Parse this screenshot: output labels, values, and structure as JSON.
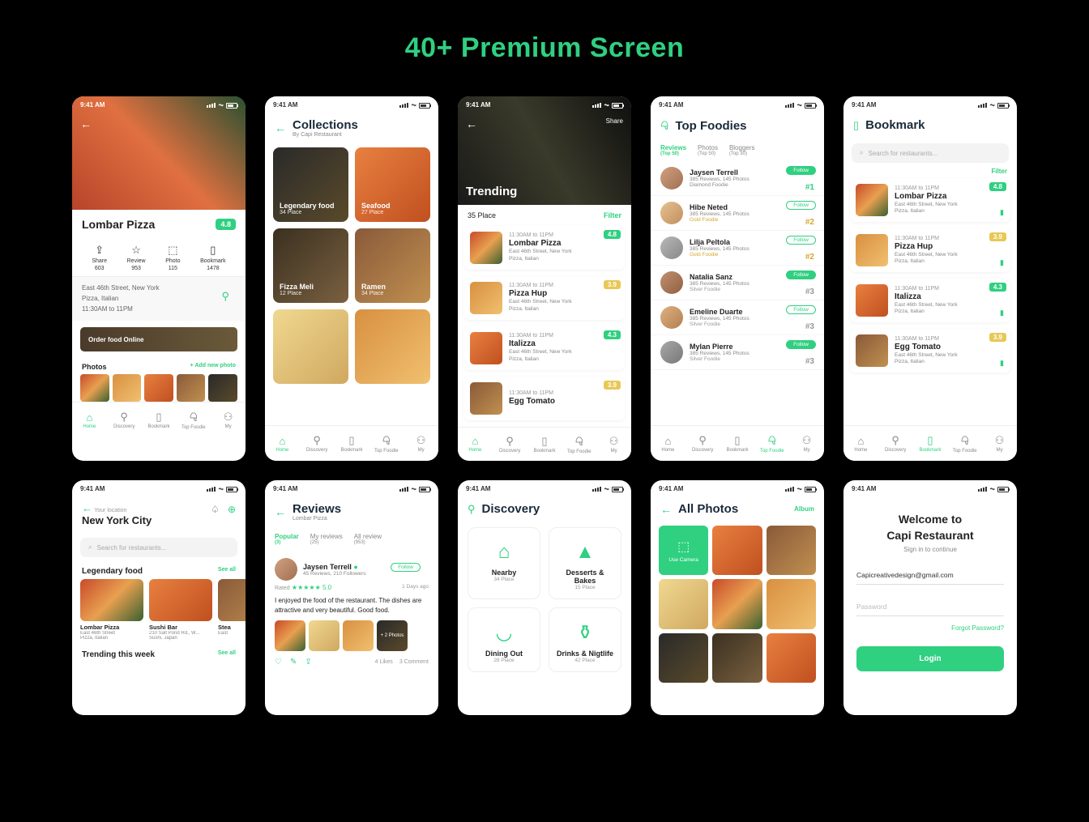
{
  "headline": "40+ Premium Screen",
  "statusTime": "9:41 AM",
  "nav": {
    "home": "Home",
    "discovery": "Discovery",
    "bookmark": "Bookmark",
    "topfoodie": "Top Foodie",
    "my": "My"
  },
  "s1": {
    "title": "Lombar Pizza",
    "rating": "4.8",
    "actions": {
      "share": {
        "l": "Share",
        "c": "603"
      },
      "review": {
        "l": "Review",
        "c": "953"
      },
      "photo": {
        "l": "Photo",
        "c": "115"
      },
      "bookmark": {
        "l": "Bookmark",
        "c": "1478"
      }
    },
    "addr": "East 46th Street, New York",
    "tags": "Pizza, Italian",
    "hours": "11:30AM to 11PM",
    "order": "Order food Online",
    "photos": "Photos",
    "addnew": "+ Add new photo"
  },
  "s2": {
    "title": "Collections",
    "sub": "By Capi Restaurant",
    "c": [
      {
        "n": "Legendary food",
        "p": "34 Place"
      },
      {
        "n": "Seafood",
        "p": "27 Place"
      },
      {
        "n": "Fizza Meli",
        "p": "12 Place"
      },
      {
        "n": "Ramen",
        "p": "34 Place"
      }
    ]
  },
  "s3": {
    "share": "Share",
    "hero": "Trending",
    "count": "35 Place",
    "filter": "Filter",
    "items": [
      {
        "t": "11:30AM to 11PM",
        "n": "Lombar Pizza",
        "a": "East 46th Street, New York",
        "g": "Pizza, Italian",
        "r": "4.8",
        "c": "g"
      },
      {
        "t": "11:30AM to 11PM",
        "n": "Pizza Hup",
        "a": "East 46th Street, New York",
        "g": "Pizza, Italian",
        "r": "3.9",
        "c": "y"
      },
      {
        "t": "11:30AM to 11PM",
        "n": "Italizza",
        "a": "East 46th Street, New York",
        "g": "Pizza, Italian",
        "r": "4.3",
        "c": "g"
      },
      {
        "t": "11:30AM to 11PM",
        "n": "Egg Tomato",
        "a": "",
        "g": "",
        "r": "3.9",
        "c": "y"
      }
    ]
  },
  "s4": {
    "title": "Top Foodies",
    "tabs": [
      {
        "l": "Reviews",
        "s": "(Top 50)"
      },
      {
        "l": "Photos",
        "s": "(Top 50)"
      },
      {
        "l": "Bloggers",
        "s": "(Top 30)"
      }
    ],
    "list": [
      {
        "n": "Jaysen Terrell",
        "s": "385 Reviews, 145 Photos",
        "tier": "Diamond Foodie",
        "tc": "diamond",
        "rank": "#1",
        "rc": "#2fd080",
        "f": true
      },
      {
        "n": "Hibe Neted",
        "s": "385 Reviews, 145 Photos",
        "tier": "Gold Foodie",
        "tc": "gold",
        "rank": "#2",
        "rc": "#d4a830",
        "f": false
      },
      {
        "n": "Lilja Peltola",
        "s": "385 Reviews, 145 Photos",
        "tier": "Gold Foodie",
        "tc": "gold",
        "rank": "#2",
        "rc": "#d4a830",
        "f": false
      },
      {
        "n": "Natalia Sanz",
        "s": "385 Reviews, 145 Photos",
        "tier": "Silver Foodie",
        "tc": "silver",
        "rank": "#3",
        "rc": "#999",
        "f": true
      },
      {
        "n": "Emeline Duarte",
        "s": "385 Reviews, 145 Photos",
        "tier": "Silver Foodie",
        "tc": "silver",
        "rank": "#3",
        "rc": "#999",
        "f": false
      },
      {
        "n": "Mylan Pierre",
        "s": "385 Reviews, 145 Photos",
        "tier": "Silver Foodie",
        "tc": "silver",
        "rank": "#3",
        "rc": "#999",
        "f": true
      }
    ],
    "follow": "Follow"
  },
  "s5": {
    "title": "Bookmark",
    "search": "Search for restaurants...",
    "filter": "Filter",
    "items": [
      {
        "t": "11:30AM to 11PM",
        "n": "Lombar Pizza",
        "a": "East 46th Street, New York",
        "g": "Pizza, Italian",
        "r": "4.8",
        "c": "g"
      },
      {
        "t": "11:30AM to 11PM",
        "n": "Pizza Hup",
        "a": "East 46th Street, New York",
        "g": "Pizza, Italian",
        "r": "3.9",
        "c": "y"
      },
      {
        "t": "11:30AM to 11PM",
        "n": "Italizza",
        "a": "East 46th Street, New York",
        "g": "Pizza, Italian",
        "r": "4.3",
        "c": "g"
      },
      {
        "t": "11:30AM to 11PM",
        "n": "Egg Tomato",
        "a": "East 46th Street, New York",
        "g": "Pizza, Italian",
        "r": "3.9",
        "c": "y"
      }
    ]
  },
  "s6": {
    "locLabel": "Your location",
    "city": "New York City",
    "search": "Search for restaurants...",
    "sec1": "Legendary food",
    "sec2": "Trending this week",
    "seeall": "See all",
    "cards": [
      {
        "n": "Lombar Pizza",
        "a": "East 46th Street",
        "g": "Pizza, Italian"
      },
      {
        "n": "Sushi Bar",
        "a": "210 Salt Pond Rd., W...",
        "g": "Sushi, Japan"
      },
      {
        "n": "Stea",
        "a": "East",
        "g": ""
      }
    ]
  },
  "s7": {
    "title": "Reviews",
    "sub": "Lombar Pizza",
    "tabs": [
      {
        "l": "Popular",
        "c": "(3)"
      },
      {
        "l": "My reviews",
        "c": "(25)"
      },
      {
        "l": "All review",
        "c": "(953)"
      }
    ],
    "user": "Jaysen Terrell",
    "ustats": "45 Reviews, 210 Followers",
    "follow": "Follow",
    "rated": "Rated",
    "score": "5.0",
    "ago": "1 Days ago",
    "text": "I enjoyed the food of the restaurant. The dishes are attractive and very beautiful. Good food.",
    "more": "+ 2 Photos",
    "likes": "4 Likes",
    "comments": "3 Comment"
  },
  "s8": {
    "title": "Discovery",
    "cards": [
      {
        "n": "Nearby",
        "c": "34 Place"
      },
      {
        "n": "Desserts & Bakes",
        "c": "15 Place"
      },
      {
        "n": "Dining Out",
        "c": "28 Place"
      },
      {
        "n": "Drinks & Nigtlife",
        "c": "42 Place"
      }
    ]
  },
  "s9": {
    "title": "All Photos",
    "album": "Album",
    "cam": "Use Camera"
  },
  "s10": {
    "welcome": "Welcome to",
    "brand": "Capi Restaurant",
    "sub": "Sign in to continue",
    "email": "Capicreativedesign@gmail.com",
    "pw": "Password",
    "forgot": "Forgot Password?",
    "login": "Login"
  }
}
